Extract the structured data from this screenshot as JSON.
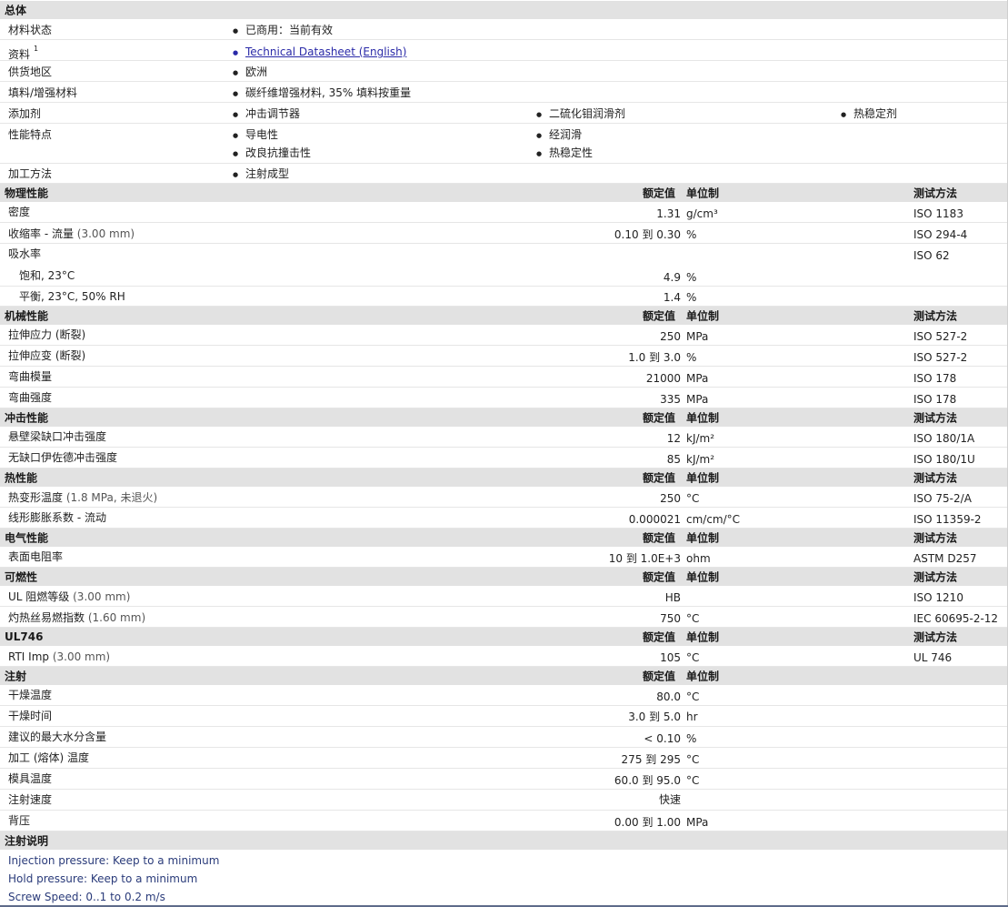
{
  "general": {
    "header": "总体",
    "rows": [
      {
        "label": "材料状态",
        "items": [
          "已商用：当前有效"
        ]
      },
      {
        "label": "资料",
        "sup": "1",
        "link": "Technical Datasheet (English)"
      },
      {
        "label": "供货地区",
        "items": [
          "欧洲"
        ]
      },
      {
        "label": "填料/增强材料",
        "items": [
          "碳纤维增强材料, 35% 填料按重量"
        ]
      },
      {
        "label": "添加剂",
        "items": [
          "冲击调节器",
          "二硫化钼润滑剂",
          "热稳定剂"
        ]
      },
      {
        "label": "性能特点",
        "items": [
          "导电性",
          "经润滑",
          "改良抗撞击性",
          "热稳定性"
        ]
      },
      {
        "label": "加工方法",
        "items": [
          "注射成型"
        ]
      }
    ]
  },
  "col_headers": {
    "nominal": "额定值",
    "unit": "单位制",
    "method": "测试方法"
  },
  "sections": {
    "physical": {
      "title": "物理性能",
      "rows": [
        {
          "label": "密度",
          "value": "1.31",
          "unit": "g/cm³",
          "method": "ISO 1183"
        },
        {
          "label": "收缩率 - 流量",
          "cond": "(3.00 mm)",
          "value": "0.10 到 0.30",
          "unit": "%",
          "method": "ISO 294-4"
        },
        {
          "label": "吸水率",
          "value": "",
          "unit": "",
          "method": "ISO 62"
        },
        {
          "label": "饱和, 23°C",
          "value": "4.9",
          "unit": "%",
          "method": ""
        },
        {
          "label": "平衡, 23°C, 50% RH",
          "value": "1.4",
          "unit": "%",
          "method": ""
        }
      ]
    },
    "mechanical": {
      "title": "机械性能",
      "rows": [
        {
          "label": "拉伸应力 (断裂)",
          "value": "250",
          "unit": "MPa",
          "method": "ISO 527-2"
        },
        {
          "label": "拉伸应变 (断裂)",
          "value": "1.0 到 3.0",
          "unit": "%",
          "method": "ISO 527-2"
        },
        {
          "label": "弯曲模量",
          "value": "21000",
          "unit": "MPa",
          "method": "ISO 178"
        },
        {
          "label": "弯曲强度",
          "value": "335",
          "unit": "MPa",
          "method": "ISO 178"
        }
      ]
    },
    "impact": {
      "title": "冲击性能",
      "rows": [
        {
          "label": "悬壁梁缺口冲击强度",
          "value": "12",
          "unit": "kJ/m²",
          "method": "ISO 180/1A"
        },
        {
          "label": "无缺口伊佐德冲击强度",
          "value": "85",
          "unit": "kJ/m²",
          "method": "ISO 180/1U"
        }
      ]
    },
    "thermal": {
      "title": "热性能",
      "rows": [
        {
          "label": "热变形温度",
          "cond": "(1.8 MPa, 未退火)",
          "value": "250",
          "unit": "°C",
          "method": "ISO 75-2/A"
        },
        {
          "label": "线形膨胀系数 - 流动",
          "value": "0.000021",
          "unit": "cm/cm/°C",
          "method": "ISO 11359-2"
        }
      ]
    },
    "electrical": {
      "title": "电气性能",
      "rows": [
        {
          "label": "表面电阻率",
          "value": "10 到 1.0E+3",
          "unit": "ohm",
          "method": "ASTM D257"
        }
      ]
    },
    "flammability": {
      "title": "可燃性",
      "rows": [
        {
          "label": "UL 阻燃等级",
          "cond": "(3.00 mm)",
          "value": "HB",
          "unit": "",
          "method": "ISO 1210"
        },
        {
          "label": "灼热丝易燃指数",
          "cond": "(1.60 mm)",
          "value": "750",
          "unit": "°C",
          "method": "IEC 60695-2-12"
        }
      ]
    },
    "ul746": {
      "title": "UL746",
      "rows": [
        {
          "label": "RTI Imp",
          "cond": "(3.00 mm)",
          "value": "105",
          "unit": "°C",
          "method": "UL 746"
        }
      ]
    },
    "injection": {
      "title": "注射",
      "rows": [
        {
          "label": "干燥温度",
          "value": "80.0",
          "unit": "°C"
        },
        {
          "label": "干燥时间",
          "value": "3.0 到 5.0",
          "unit": "hr"
        },
        {
          "label": "建议的最大水分含量",
          "value": "< 0.10",
          "unit": "%"
        },
        {
          "label": "加工 (熔体) 温度",
          "value": "275 到 295",
          "unit": "°C"
        },
        {
          "label": "模具温度",
          "value": "60.0 到 95.0",
          "unit": "°C"
        },
        {
          "label": "注射速度",
          "value": "快速",
          "unit": ""
        },
        {
          "label": "背压",
          "value": "0.00 到 1.00",
          "unit": "MPa"
        }
      ]
    }
  },
  "notes": {
    "title": "注射说明",
    "lines": [
      "Injection pressure: Keep to a minimum",
      "Hold pressure: Keep to a minimum",
      "Screw Speed: 0..1 to 0.2 m/s"
    ]
  }
}
